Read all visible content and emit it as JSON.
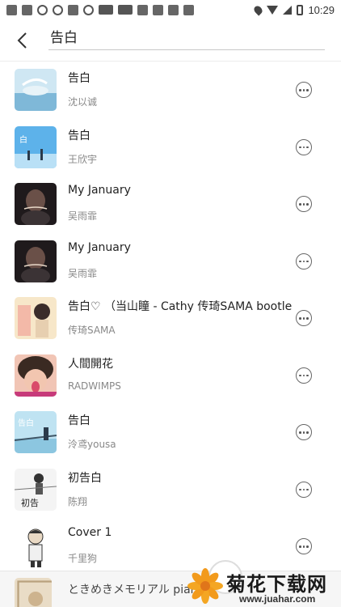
{
  "status_bar": {
    "time": "10:29",
    "left_icons": [
      "notification-icon",
      "notification-icon",
      "notification-icon",
      "notification-icon",
      "notification-icon",
      "news-app-icon",
      "news-app-icon",
      "app-icon",
      "app-icon",
      "app-icon",
      "app-icon",
      "app-icon"
    ],
    "right_icons": [
      "location-icon",
      "wifi-icon",
      "signal-icon",
      "battery-icon"
    ]
  },
  "header": {
    "back_icon": "chevron-left-icon",
    "query": "告白"
  },
  "songs": [
    {
      "title": "告白",
      "artist": "沈以诚",
      "cover": "cover-whale"
    },
    {
      "title": "告白",
      "artist": "王欣宇",
      "cover": "cover-blue"
    },
    {
      "title": "My January",
      "artist": "吴雨霏",
      "cover": "cover-dark"
    },
    {
      "title": "My January",
      "artist": "吴雨霏",
      "cover": "cover-dark"
    },
    {
      "title": "告白♡ （当山瞳 - Cathy 传琦SAMA bootleg)",
      "artist": "传琦SAMA",
      "cover": "cover-anime"
    },
    {
      "title": "人間開花",
      "artist": "RADWIMPS",
      "cover": "cover-face"
    },
    {
      "title": "告白",
      "artist": "泠鸢yousa",
      "cover": "cover-bridge"
    },
    {
      "title": "初告白",
      "artist": "陈翔",
      "cover": "cover-sketch"
    },
    {
      "title": "Cover 1",
      "artist": "千里狗",
      "cover": "cover-cartoon"
    }
  ],
  "more_icon": "more-circle-icon",
  "bottom_row": {
    "title": "ときめきメモリアル pian"
  },
  "watermark": {
    "title": "菊花下载网",
    "url": "www.juahar.com"
  },
  "colors": {
    "title_text": "#222222",
    "artist_text": "#888888",
    "divider": "#ececec"
  }
}
